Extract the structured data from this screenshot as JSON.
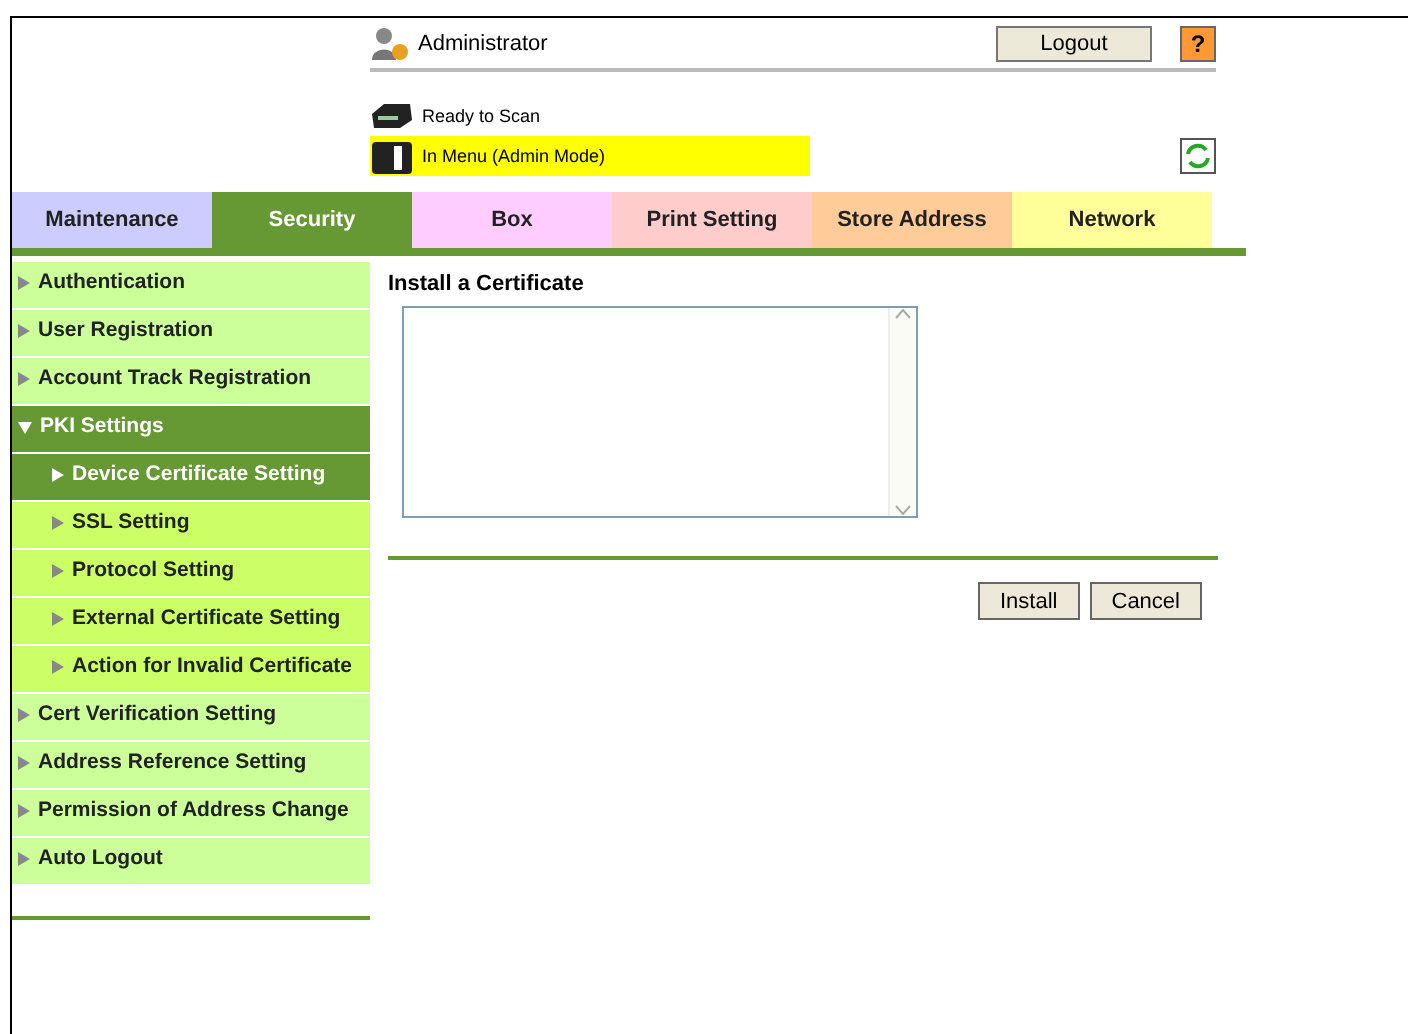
{
  "header": {
    "user": "Administrator",
    "logout": "Logout",
    "help": "?",
    "status": [
      {
        "text": "Ready to Scan",
        "highlighted": false
      },
      {
        "text": "In Menu (Admin Mode)",
        "highlighted": true
      }
    ]
  },
  "tabs": [
    {
      "label": "Maintenance",
      "selected": false,
      "color": "#ccccff"
    },
    {
      "label": "Security",
      "selected": true,
      "color": "#669933"
    },
    {
      "label": "Box",
      "selected": false,
      "color": "#ffccff"
    },
    {
      "label": "Print Setting",
      "selected": false,
      "color": "#ffcccc"
    },
    {
      "label": "Store Address",
      "selected": false,
      "color": "#ffcc99"
    },
    {
      "label": "Network",
      "selected": false,
      "color": "#ffff99"
    }
  ],
  "sidebar": {
    "items": [
      {
        "label": "Authentication",
        "selected": false
      },
      {
        "label": "User Registration",
        "selected": false
      },
      {
        "label": "Account Track Registration",
        "selected": false
      },
      {
        "label": "PKI Settings",
        "selected": true,
        "expanded": true,
        "children": [
          {
            "label": "Device Certificate Setting",
            "selected": true
          },
          {
            "label": "SSL Setting",
            "selected": false
          },
          {
            "label": "Protocol Setting",
            "selected": false
          },
          {
            "label": "External Certificate Setting",
            "selected": false
          },
          {
            "label": "Action for Invalid Certificate",
            "selected": false
          }
        ]
      },
      {
        "label": "Cert Verification Setting",
        "selected": false
      },
      {
        "label": "Address Reference Setting",
        "selected": false
      },
      {
        "label": "Permission of Address Change",
        "selected": false
      },
      {
        "label": "Auto Logout",
        "selected": false
      }
    ]
  },
  "content": {
    "title": "Install a Certificate",
    "buttons": [
      "Install",
      "Cancel"
    ]
  }
}
